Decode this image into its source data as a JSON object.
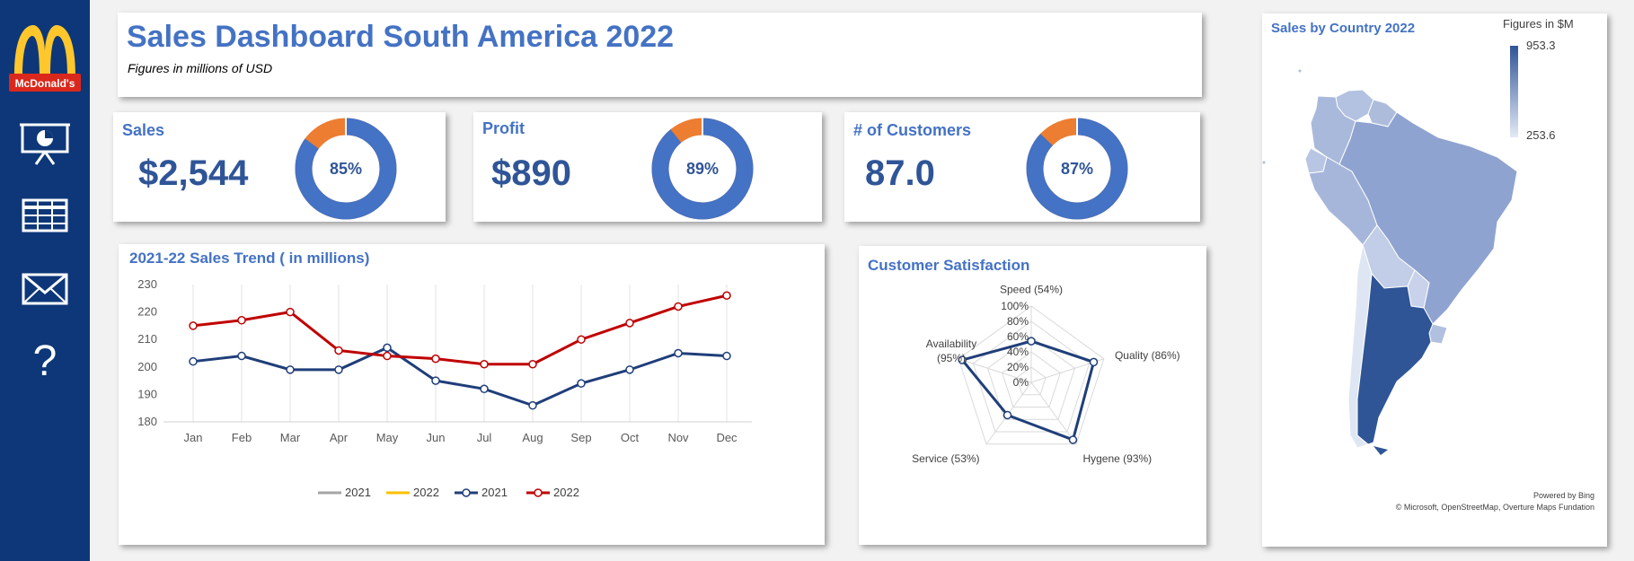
{
  "header": {
    "title": "Sales Dashboard South America 2022",
    "subtitle": "Figures in millions of USD"
  },
  "sidebar": {
    "logo_text": "McDonald's",
    "icons": [
      "presentation-icon",
      "table-icon",
      "mail-icon",
      "help-icon"
    ]
  },
  "colors": {
    "sidebar": "#0d3778",
    "accent": "#4472c4",
    "kpi_value": "#2f5597",
    "donut_remainder": "#ed7d31",
    "series_2021": "#1f3e7a",
    "series_2022": "#c00000"
  },
  "kpis": [
    {
      "label": "Sales",
      "value": "$2,544",
      "percent": 85,
      "percent_label": "85%"
    },
    {
      "label": "Profit",
      "value": "$890",
      "percent": 89,
      "percent_label": "89%"
    },
    {
      "label": "# of Customers",
      "value": "87.0",
      "percent": 87,
      "percent_label": "87%"
    }
  ],
  "trend": {
    "title": "2021-22 Sales Trend ( in millions)"
  },
  "satisfaction": {
    "title": "Customer Satisfaction"
  },
  "map": {
    "title": "Sales by Country 2022",
    "legend_title": "Figures in $M",
    "legend_max": "953.3",
    "legend_min": "253.6",
    "powered_by": "Powered by Bing",
    "copyright": "© Microsoft, OpenStreetMap, Overture Maps Fundation"
  },
  "chart_data": [
    {
      "type": "line",
      "title": "2021-22 Sales Trend ( in millions)",
      "categories": [
        "Jan",
        "Feb",
        "Mar",
        "Apr",
        "May",
        "Jun",
        "Jul",
        "Aug",
        "Sep",
        "Oct",
        "Nov",
        "Dec"
      ],
      "ylim": [
        180,
        230
      ],
      "yticks": [
        "180",
        "190",
        "200",
        "210",
        "220",
        "230"
      ],
      "series": [
        {
          "name": "2021",
          "values": [
            202,
            204,
            199,
            199,
            207,
            195,
            192,
            186,
            194,
            199,
            205,
            204
          ]
        },
        {
          "name": "2022",
          "values": [
            215,
            217,
            220,
            206,
            204,
            203,
            201,
            201,
            210,
            216,
            222,
            226
          ]
        }
      ],
      "legend": [
        {
          "name": "2021",
          "color": "#a5a5a5",
          "marker": false
        },
        {
          "name": "2022",
          "color": "#ffc000",
          "marker": false
        },
        {
          "name": "2021",
          "color": "#1f3e7a",
          "marker": true
        },
        {
          "name": "2022",
          "color": "#c00000",
          "marker": true
        }
      ],
      "legend_position": "bottom",
      "grid": "vertical"
    },
    {
      "type": "radar",
      "title": "Customer Satisfaction",
      "categories": [
        "Speed (54%)",
        "Quality (86%)",
        "Hygene (93%)",
        "Service (53%)",
        "Availability (95%)"
      ],
      "values": [
        54,
        86,
        93,
        53,
        95
      ],
      "ticks": [
        "0%",
        "20%",
        "40%",
        "60%",
        "80%",
        "100%"
      ],
      "rlim": [
        0,
        100
      ]
    },
    {
      "type": "map",
      "title": "Sales by Country 2022",
      "legend_title": "Figures in $M",
      "range": [
        253.6,
        953.3
      ]
    }
  ]
}
